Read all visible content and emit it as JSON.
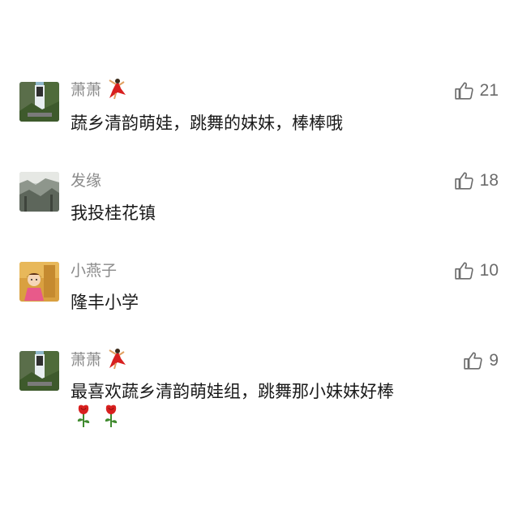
{
  "comments": [
    {
      "name": "萧萧",
      "text": "蔬乡清韵萌娃，跳舞的妹妹，棒棒哦",
      "likes": "21",
      "avatar_icon": "waterfall-landscape-avatar",
      "has_dancer_emoji": true
    },
    {
      "name": "发缘",
      "text": "我投桂花镇",
      "likes": "18",
      "avatar_icon": "misty-forest-avatar",
      "has_dancer_emoji": false
    },
    {
      "name": "小燕子",
      "text": "隆丰小学",
      "likes": "10",
      "avatar_icon": "cartoon-girl-avatar",
      "has_dancer_emoji": false
    },
    {
      "name": "萧萧",
      "text": "最喜欢蔬乡清韵萌娃组，跳舞那小妹妹好棒",
      "likes": "9",
      "avatar_icon": "waterfall-landscape-avatar",
      "has_dancer_emoji": true,
      "extra_emojis": [
        "rose-icon",
        "rose-icon"
      ]
    }
  ],
  "colors": {
    "name": "#8a8a8a",
    "text": "#1a1a1a",
    "like": "#6b6b6b"
  }
}
